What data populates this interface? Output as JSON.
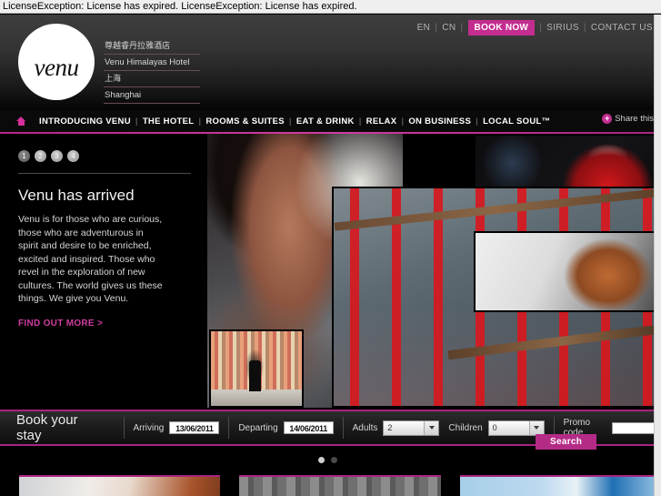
{
  "license_bar": {
    "message": "LicenseException: License has expired. LicenseException: License has expired."
  },
  "header": {
    "logo_text": "venu",
    "hotel_lines": [
      "尊越睿丹拉雅酒店",
      "Venu Himalayas Hotel",
      "上海",
      "Shanghai"
    ],
    "top_nav": {
      "lang_en": "EN",
      "lang_cn": "CN",
      "book_now": "BOOK NOW",
      "sirius": "SIRIUS",
      "contact_us": "CONTACT US",
      "separator": "|"
    }
  },
  "main_nav": {
    "home_icon": "home-icon",
    "separator": "|",
    "items": [
      "INTRODUCING VENU",
      "THE HOTEL",
      "ROOMS & SUITES",
      "EAT & DRINK",
      "RELAX",
      "ON BUSINESS",
      "LOCAL SOUL™"
    ],
    "share": {
      "plus_icon": "+",
      "label": "Share this"
    }
  },
  "hero": {
    "pager": [
      {
        "label": "1",
        "active": true
      },
      {
        "label": "2",
        "active": false
      },
      {
        "label": "3",
        "active": false
      },
      {
        "label": "4",
        "active": false
      }
    ],
    "title": "Venu has arrived",
    "body": "Venu is for those who are curious, those who are adventurous in spirit and desire to be enriched, excited and inspired. Those who revel in the exploration of new cultures. The world gives us these things. We give you Venu.",
    "cta": "FIND OUT MORE >",
    "collage": [
      {
        "name": "woman-profile-photo"
      },
      {
        "name": "red-teapot-photo"
      },
      {
        "name": "red-ribbons-photo"
      },
      {
        "name": "redhead-woman-photo"
      },
      {
        "name": "walking-man-photo"
      }
    ]
  },
  "booking": {
    "title": "Book your stay",
    "arriving_label": "Arriving",
    "arriving_value": "13/06/2011",
    "departing_label": "Departing",
    "departing_value": "14/06/2011",
    "adults_label": "Adults",
    "adults_value": "2",
    "children_label": "Children",
    "children_value": "0",
    "promo_label": "Promo code",
    "promo_value": "",
    "search_label": "Search"
  },
  "lower_carousel": {
    "dots": [
      {
        "active": true
      },
      {
        "active": false
      }
    ],
    "thumbs": [
      {
        "name": "thumb-spa"
      },
      {
        "name": "thumb-interior"
      },
      {
        "name": "thumb-pool"
      }
    ]
  },
  "colors": {
    "accent_magenta": "#c32d8f",
    "rule_magenta": "#a8247f",
    "background": "#000000",
    "header_top": "#3e3e3e"
  }
}
